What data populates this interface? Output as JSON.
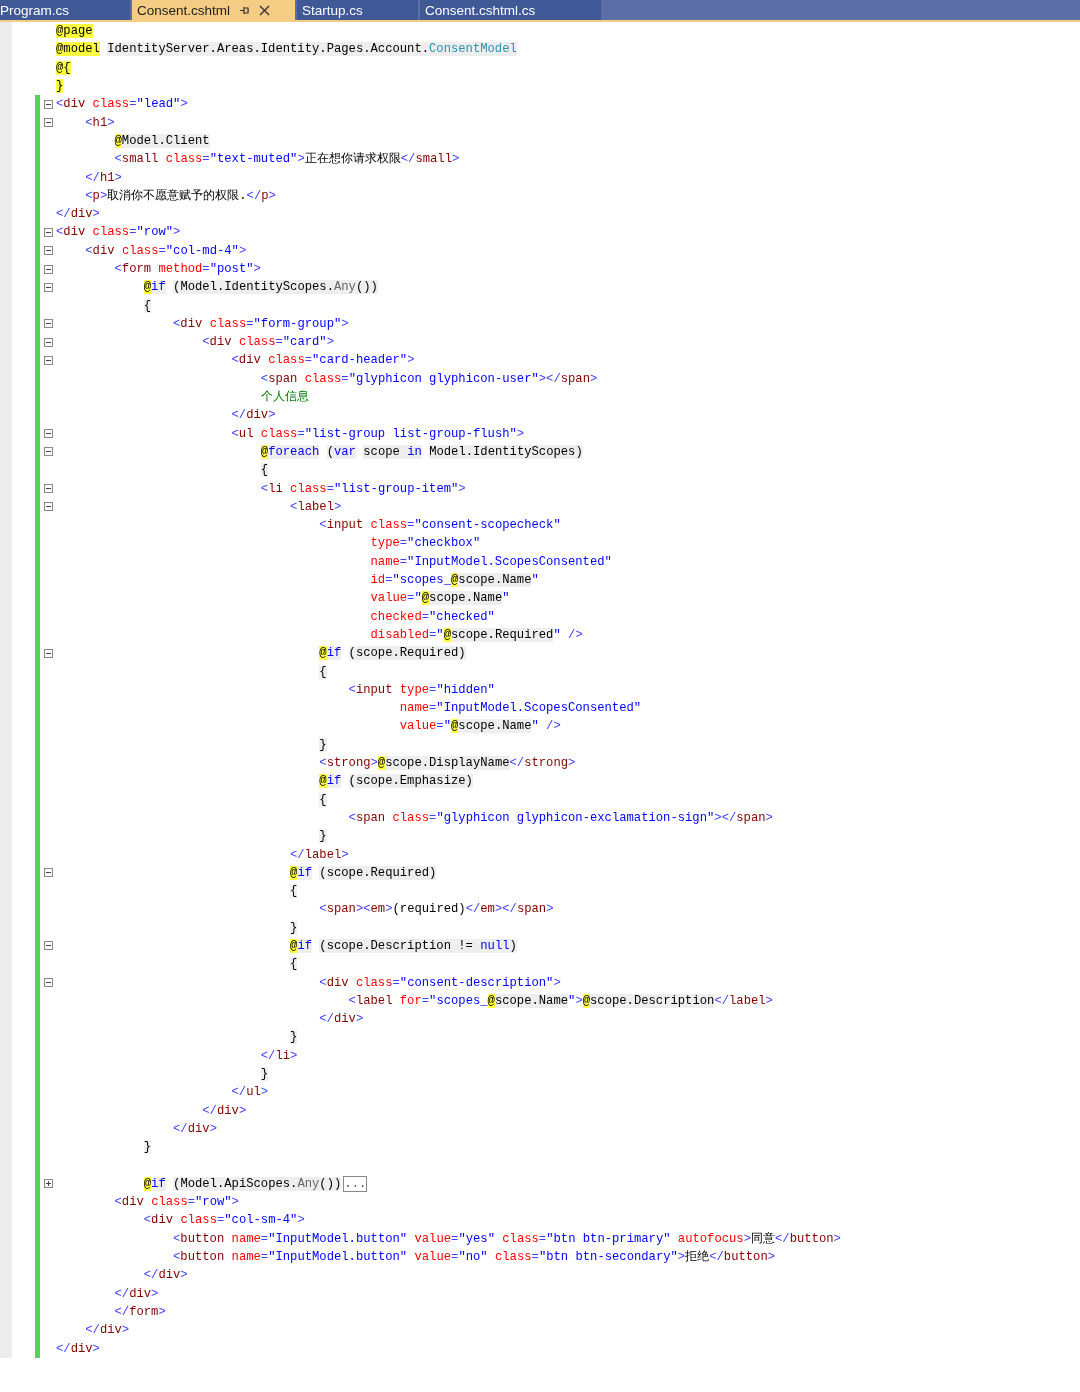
{
  "tabs": [
    {
      "label": "Program.cs",
      "selected": false
    },
    {
      "label": "Consent.cshtml",
      "selected": true
    },
    {
      "label": "Startup.cs",
      "selected": false
    },
    {
      "label": "Consent.cshtml.cs",
      "selected": false
    }
  ],
  "lines": [
    {
      "t": [
        {
          "kind": "at",
          "text": "@page"
        }
      ]
    },
    {
      "t": [
        {
          "kind": "at",
          "text": "@model"
        },
        {
          "kind": "cs",
          "text": " IdentityServer.Areas.Identity.Pages.Account."
        },
        {
          "kind": "ty",
          "text": "ConsentModel"
        }
      ]
    },
    {
      "t": [
        {
          "kind": "at",
          "text": "@{"
        }
      ]
    },
    {
      "t": [
        {
          "kind": "at",
          "text": "}"
        }
      ]
    },
    {
      "changed": true,
      "expanded": true,
      "t": [
        {
          "kind": "p",
          "text": "<"
        },
        {
          "kind": "tag",
          "text": "div"
        },
        {
          "kind": "attr",
          "text": " class"
        },
        {
          "kind": "p",
          "text": "="
        },
        {
          "kind": "str",
          "text": "\"lead\""
        },
        {
          "kind": "p",
          "text": ">"
        }
      ]
    },
    {
      "changed": true,
      "expanded": true,
      "t": [
        {
          "kind": "p",
          "text": "    <"
        },
        {
          "kind": "tag",
          "text": "h1"
        },
        {
          "kind": "p",
          "text": ">"
        }
      ]
    },
    {
      "changed": true,
      "t": [
        {
          "kind": "at",
          "text": "        @"
        },
        {
          "kind": "cs",
          "text": "Model.Client"
        }
      ]
    },
    {
      "changed": true,
      "t": [
        {
          "kind": "p",
          "text": "        <"
        },
        {
          "kind": "tag",
          "text": "small"
        },
        {
          "kind": "attr",
          "text": " class"
        },
        {
          "kind": "p",
          "text": "="
        },
        {
          "kind": "str",
          "text": "\"text-muted\""
        },
        {
          "kind": "p",
          "text": ">"
        },
        {
          "kind": "txt",
          "text": "正在想你请求权限"
        },
        {
          "kind": "p",
          "text": "</"
        },
        {
          "kind": "tag",
          "text": "small"
        },
        {
          "kind": "p",
          "text": ">"
        }
      ]
    },
    {
      "changed": true,
      "t": [
        {
          "kind": "p",
          "text": "    </"
        },
        {
          "kind": "tag",
          "text": "h1"
        },
        {
          "kind": "p",
          "text": ">"
        }
      ]
    },
    {
      "changed": true,
      "t": [
        {
          "kind": "p",
          "text": "    <"
        },
        {
          "kind": "tag",
          "text": "p"
        },
        {
          "kind": "p",
          "text": ">"
        },
        {
          "kind": "txt",
          "text": "取消你不愿意赋予的权限."
        },
        {
          "kind": "p",
          "text": "</"
        },
        {
          "kind": "tag",
          "text": "p"
        },
        {
          "kind": "p",
          "text": ">"
        }
      ]
    },
    {
      "changed": true,
      "t": [
        {
          "kind": "p",
          "text": "</"
        },
        {
          "kind": "tag",
          "text": "div"
        },
        {
          "kind": "p",
          "text": ">"
        }
      ]
    },
    {
      "changed": true,
      "expanded": true,
      "t": [
        {
          "kind": "p",
          "text": "<"
        },
        {
          "kind": "tag",
          "text": "div"
        },
        {
          "kind": "attr",
          "text": " class"
        },
        {
          "kind": "p",
          "text": "="
        },
        {
          "kind": "str",
          "text": "\"row\""
        },
        {
          "kind": "p",
          "text": ">"
        }
      ]
    },
    {
      "changed": true,
      "expanded": true,
      "t": [
        {
          "kind": "p",
          "text": "    <"
        },
        {
          "kind": "tag",
          "text": "div"
        },
        {
          "kind": "attr",
          "text": " class"
        },
        {
          "kind": "p",
          "text": "="
        },
        {
          "kind": "str",
          "text": "\"col-md-4\""
        },
        {
          "kind": "p",
          "text": ">"
        }
      ]
    },
    {
      "changed": true,
      "expanded": true,
      "t": [
        {
          "kind": "p",
          "text": "        <"
        },
        {
          "kind": "tag",
          "text": "form"
        },
        {
          "kind": "attr",
          "text": " method"
        },
        {
          "kind": "p",
          "text": "="
        },
        {
          "kind": "str",
          "text": "\"post\""
        },
        {
          "kind": "p",
          "text": ">"
        }
      ]
    },
    {
      "changed": true,
      "expanded": true,
      "t": [
        {
          "kind": "at",
          "text": "            @"
        },
        {
          "kind": "kw",
          "text": "if"
        },
        {
          "kind": "cs",
          "text": " (Model.IdentityScopes."
        },
        {
          "kind": "dim",
          "text": "Any"
        },
        {
          "kind": "cs",
          "text": "())"
        }
      ]
    },
    {
      "changed": true,
      "t": [
        {
          "kind": "cs",
          "text": "            {"
        }
      ]
    },
    {
      "changed": true,
      "expanded": true,
      "t": [
        {
          "kind": "p",
          "text": "                <"
        },
        {
          "kind": "tag",
          "text": "div"
        },
        {
          "kind": "attr",
          "text": " class"
        },
        {
          "kind": "p",
          "text": "="
        },
        {
          "kind": "str",
          "text": "\"form-group\""
        },
        {
          "kind": "p",
          "text": ">"
        }
      ]
    },
    {
      "changed": true,
      "expanded": true,
      "t": [
        {
          "kind": "p",
          "text": "                    <"
        },
        {
          "kind": "tag",
          "text": "div"
        },
        {
          "kind": "attr",
          "text": " class"
        },
        {
          "kind": "p",
          "text": "="
        },
        {
          "kind": "str",
          "text": "\"card\""
        },
        {
          "kind": "p",
          "text": ">"
        }
      ]
    },
    {
      "changed": true,
      "expanded": true,
      "t": [
        {
          "kind": "p",
          "text": "                        <"
        },
        {
          "kind": "tag",
          "text": "div"
        },
        {
          "kind": "attr",
          "text": " class"
        },
        {
          "kind": "p",
          "text": "="
        },
        {
          "kind": "str",
          "text": "\"card-header\""
        },
        {
          "kind": "p",
          "text": ">"
        }
      ]
    },
    {
      "changed": true,
      "t": [
        {
          "kind": "p",
          "text": "                            <"
        },
        {
          "kind": "tag",
          "text": "span"
        },
        {
          "kind": "attr",
          "text": " class"
        },
        {
          "kind": "p",
          "text": "="
        },
        {
          "kind": "str",
          "text": "\"glyphicon glyphicon-user\""
        },
        {
          "kind": "p",
          "text": "></"
        },
        {
          "kind": "tag",
          "text": "span"
        },
        {
          "kind": "p",
          "text": ">"
        }
      ]
    },
    {
      "changed": true,
      "t": [
        {
          "kind": "grn",
          "text": "                            个人信息"
        }
      ]
    },
    {
      "changed": true,
      "t": [
        {
          "kind": "p",
          "text": "                        </"
        },
        {
          "kind": "tag",
          "text": "div"
        },
        {
          "kind": "p",
          "text": ">"
        }
      ]
    },
    {
      "changed": true,
      "expanded": true,
      "t": [
        {
          "kind": "p",
          "text": "                        <"
        },
        {
          "kind": "tag",
          "text": "ul"
        },
        {
          "kind": "attr",
          "text": " class"
        },
        {
          "kind": "p",
          "text": "="
        },
        {
          "kind": "str",
          "text": "\"list-group list-group-flush\""
        },
        {
          "kind": "p",
          "text": ">"
        }
      ]
    },
    {
      "changed": true,
      "expanded": true,
      "t": [
        {
          "kind": "at",
          "text": "                            @"
        },
        {
          "kind": "kw",
          "text": "foreach"
        },
        {
          "kind": "cs",
          "text": " ("
        },
        {
          "kind": "kw",
          "text": "var"
        },
        {
          "kind": "cs",
          "text": " scope "
        },
        {
          "kind": "kw",
          "text": "in"
        },
        {
          "kind": "cs",
          "text": " Model.IdentityScopes)"
        }
      ]
    },
    {
      "changed": true,
      "t": [
        {
          "kind": "cs",
          "text": "                            {"
        }
      ]
    },
    {
      "changed": true,
      "expanded": true,
      "t": [
        {
          "kind": "p",
          "text": "                            <"
        },
        {
          "kind": "tag",
          "text": "li"
        },
        {
          "kind": "attr",
          "text": " class"
        },
        {
          "kind": "p",
          "text": "="
        },
        {
          "kind": "str",
          "text": "\"list-group-item\""
        },
        {
          "kind": "p",
          "text": ">"
        }
      ]
    },
    {
      "changed": true,
      "expanded": true,
      "t": [
        {
          "kind": "p",
          "text": "                                <"
        },
        {
          "kind": "tag",
          "text": "label"
        },
        {
          "kind": "p",
          "text": ">"
        }
      ]
    },
    {
      "changed": true,
      "t": [
        {
          "kind": "p",
          "text": "                                    <"
        },
        {
          "kind": "tag",
          "text": "input"
        },
        {
          "kind": "attr",
          "text": " class"
        },
        {
          "kind": "p",
          "text": "="
        },
        {
          "kind": "str",
          "text": "\"consent-scopecheck\""
        }
      ]
    },
    {
      "changed": true,
      "t": [
        {
          "kind": "attr",
          "text": "                                           type"
        },
        {
          "kind": "p",
          "text": "="
        },
        {
          "kind": "str",
          "text": "\"checkbox\""
        }
      ]
    },
    {
      "changed": true,
      "t": [
        {
          "kind": "attr",
          "text": "                                           name"
        },
        {
          "kind": "p",
          "text": "="
        },
        {
          "kind": "str",
          "text": "\"InputModel.ScopesConsented\""
        }
      ]
    },
    {
      "changed": true,
      "t": [
        {
          "kind": "attr",
          "text": "                                           id"
        },
        {
          "kind": "p",
          "text": "="
        },
        {
          "kind": "str",
          "text": "\"scopes_"
        },
        {
          "kind": "at",
          "text": "@"
        },
        {
          "kind": "cs",
          "text": "scope.Name"
        },
        {
          "kind": "str",
          "text": "\""
        }
      ]
    },
    {
      "changed": true,
      "t": [
        {
          "kind": "attr",
          "text": "                                           value"
        },
        {
          "kind": "p",
          "text": "="
        },
        {
          "kind": "str",
          "text": "\""
        },
        {
          "kind": "at",
          "text": "@"
        },
        {
          "kind": "cs",
          "text": "scope.Name"
        },
        {
          "kind": "str",
          "text": "\""
        }
      ]
    },
    {
      "changed": true,
      "t": [
        {
          "kind": "attr",
          "text": "                                           checked"
        },
        {
          "kind": "p",
          "text": "="
        },
        {
          "kind": "str",
          "text": "\"checked\""
        }
      ]
    },
    {
      "changed": true,
      "t": [
        {
          "kind": "attr",
          "text": "                                           disabled"
        },
        {
          "kind": "p",
          "text": "="
        },
        {
          "kind": "str",
          "text": "\""
        },
        {
          "kind": "at",
          "text": "@"
        },
        {
          "kind": "cs",
          "text": "scope.Required"
        },
        {
          "kind": "str",
          "text": "\""
        },
        {
          "kind": "p",
          "text": " />"
        }
      ]
    },
    {
      "changed": true,
      "expanded": true,
      "t": [
        {
          "kind": "at",
          "text": "                                    @"
        },
        {
          "kind": "kw",
          "text": "if"
        },
        {
          "kind": "cs",
          "text": " (scope.Required)"
        }
      ]
    },
    {
      "changed": true,
      "t": [
        {
          "kind": "cs",
          "text": "                                    {"
        }
      ]
    },
    {
      "changed": true,
      "t": [
        {
          "kind": "p",
          "text": "                                        <"
        },
        {
          "kind": "tag",
          "text": "input"
        },
        {
          "kind": "attr",
          "text": " type"
        },
        {
          "kind": "p",
          "text": "="
        },
        {
          "kind": "str",
          "text": "\"hidden\""
        }
      ]
    },
    {
      "changed": true,
      "t": [
        {
          "kind": "attr",
          "text": "                                               name"
        },
        {
          "kind": "p",
          "text": "="
        },
        {
          "kind": "str",
          "text": "\"InputModel.ScopesConsented\""
        }
      ]
    },
    {
      "changed": true,
      "t": [
        {
          "kind": "attr",
          "text": "                                               value"
        },
        {
          "kind": "p",
          "text": "="
        },
        {
          "kind": "str",
          "text": "\""
        },
        {
          "kind": "at",
          "text": "@"
        },
        {
          "kind": "cs",
          "text": "scope.Name"
        },
        {
          "kind": "str",
          "text": "\""
        },
        {
          "kind": "p",
          "text": " />"
        }
      ]
    },
    {
      "changed": true,
      "t": [
        {
          "kind": "cs",
          "text": "                                    }"
        }
      ]
    },
    {
      "changed": true,
      "t": [
        {
          "kind": "p",
          "text": "                                    <"
        },
        {
          "kind": "tag",
          "text": "strong"
        },
        {
          "kind": "p",
          "text": ">"
        },
        {
          "kind": "at",
          "text": "@"
        },
        {
          "kind": "cs",
          "text": "scope.DisplayName"
        },
        {
          "kind": "p",
          "text": "</"
        },
        {
          "kind": "tag",
          "text": "strong"
        },
        {
          "kind": "p",
          "text": ">"
        }
      ]
    },
    {
      "changed": true,
      "t": [
        {
          "kind": "at",
          "text": "                                    @"
        },
        {
          "kind": "kw",
          "text": "if"
        },
        {
          "kind": "cs",
          "text": " (scope.Emphasize)"
        }
      ]
    },
    {
      "changed": true,
      "t": [
        {
          "kind": "cs",
          "text": "                                    {"
        }
      ]
    },
    {
      "changed": true,
      "t": [
        {
          "kind": "p",
          "text": "                                        <"
        },
        {
          "kind": "tag",
          "text": "span"
        },
        {
          "kind": "attr",
          "text": " class"
        },
        {
          "kind": "p",
          "text": "="
        },
        {
          "kind": "str",
          "text": "\"glyphicon glyphicon-exclamation-sign\""
        },
        {
          "kind": "p",
          "text": "></"
        },
        {
          "kind": "tag",
          "text": "span"
        },
        {
          "kind": "p",
          "text": ">"
        }
      ]
    },
    {
      "changed": true,
      "t": [
        {
          "kind": "cs",
          "text": "                                    }"
        }
      ]
    },
    {
      "changed": true,
      "t": [
        {
          "kind": "p",
          "text": "                                </"
        },
        {
          "kind": "tag",
          "text": "label"
        },
        {
          "kind": "p",
          "text": ">"
        }
      ]
    },
    {
      "changed": true,
      "expanded": true,
      "t": [
        {
          "kind": "at",
          "text": "                                @"
        },
        {
          "kind": "kw",
          "text": "if"
        },
        {
          "kind": "cs",
          "text": " (scope.Required)"
        }
      ]
    },
    {
      "changed": true,
      "t": [
        {
          "kind": "cs",
          "text": "                                {"
        }
      ]
    },
    {
      "changed": true,
      "t": [
        {
          "kind": "p",
          "text": "                                    <"
        },
        {
          "kind": "tag",
          "text": "span"
        },
        {
          "kind": "p",
          "text": "><"
        },
        {
          "kind": "tag",
          "text": "em"
        },
        {
          "kind": "p",
          "text": ">"
        },
        {
          "kind": "txt",
          "text": "(required)"
        },
        {
          "kind": "p",
          "text": "</"
        },
        {
          "kind": "tag",
          "text": "em"
        },
        {
          "kind": "p",
          "text": "></"
        },
        {
          "kind": "tag",
          "text": "span"
        },
        {
          "kind": "p",
          "text": ">"
        }
      ]
    },
    {
      "changed": true,
      "t": [
        {
          "kind": "cs",
          "text": "                                }"
        }
      ]
    },
    {
      "changed": true,
      "expanded": true,
      "t": [
        {
          "kind": "at",
          "text": "                                @"
        },
        {
          "kind": "kw",
          "text": "if"
        },
        {
          "kind": "cs",
          "text": " (scope.Description != "
        },
        {
          "kind": "kw",
          "text": "null"
        },
        {
          "kind": "cs",
          "text": ")"
        }
      ]
    },
    {
      "changed": true,
      "t": [
        {
          "kind": "cs",
          "text": "                                {"
        }
      ]
    },
    {
      "changed": true,
      "expanded": true,
      "t": [
        {
          "kind": "p",
          "text": "                                    <"
        },
        {
          "kind": "tag",
          "text": "div"
        },
        {
          "kind": "attr",
          "text": " class"
        },
        {
          "kind": "p",
          "text": "="
        },
        {
          "kind": "str",
          "text": "\"consent-description\""
        },
        {
          "kind": "p",
          "text": ">"
        }
      ]
    },
    {
      "changed": true,
      "t": [
        {
          "kind": "p",
          "text": "                                        <"
        },
        {
          "kind": "tag",
          "text": "label"
        },
        {
          "kind": "attr",
          "text": " for"
        },
        {
          "kind": "p",
          "text": "="
        },
        {
          "kind": "str",
          "text": "\"scopes_"
        },
        {
          "kind": "at",
          "text": "@"
        },
        {
          "kind": "cs",
          "text": "scope.Name"
        },
        {
          "kind": "str",
          "text": "\""
        },
        {
          "kind": "p",
          "text": ">"
        },
        {
          "kind": "at",
          "text": "@"
        },
        {
          "kind": "cs",
          "text": "scope.Description"
        },
        {
          "kind": "p",
          "text": "</"
        },
        {
          "kind": "tag",
          "text": "label"
        },
        {
          "kind": "p",
          "text": ">"
        }
      ]
    },
    {
      "changed": true,
      "t": [
        {
          "kind": "p",
          "text": "                                    </"
        },
        {
          "kind": "tag",
          "text": "div"
        },
        {
          "kind": "p",
          "text": ">"
        }
      ]
    },
    {
      "changed": true,
      "t": [
        {
          "kind": "cs",
          "text": "                                }"
        }
      ]
    },
    {
      "changed": true,
      "t": [
        {
          "kind": "p",
          "text": "                            </"
        },
        {
          "kind": "tag",
          "text": "li"
        },
        {
          "kind": "p",
          "text": ">"
        }
      ]
    },
    {
      "changed": true,
      "t": [
        {
          "kind": "cs",
          "text": "                            }"
        }
      ]
    },
    {
      "changed": true,
      "t": [
        {
          "kind": "p",
          "text": "                        </"
        },
        {
          "kind": "tag",
          "text": "ul"
        },
        {
          "kind": "p",
          "text": ">"
        }
      ]
    },
    {
      "changed": true,
      "t": [
        {
          "kind": "p",
          "text": "                    </"
        },
        {
          "kind": "tag",
          "text": "div"
        },
        {
          "kind": "p",
          "text": ">"
        }
      ]
    },
    {
      "changed": true,
      "t": [
        {
          "kind": "p",
          "text": "                </"
        },
        {
          "kind": "tag",
          "text": "div"
        },
        {
          "kind": "p",
          "text": ">"
        }
      ]
    },
    {
      "changed": true,
      "t": [
        {
          "kind": "cs",
          "text": "            }"
        }
      ]
    },
    {
      "changed": true
    },
    {
      "changed": true,
      "expanded": false,
      "t": [
        {
          "kind": "at",
          "text": "            @"
        },
        {
          "kind": "kw",
          "text": "if"
        },
        {
          "kind": "cs",
          "text": " (Model.ApiScopes."
        },
        {
          "kind": "dim",
          "text": "Any"
        },
        {
          "kind": "cs",
          "text": "())"
        },
        {
          "kind": "more",
          "text": "..."
        }
      ]
    },
    {
      "changed": true,
      "t": [
        {
          "kind": "p",
          "text": "        <"
        },
        {
          "kind": "tag",
          "text": "div"
        },
        {
          "kind": "attr",
          "text": " class"
        },
        {
          "kind": "p",
          "text": "="
        },
        {
          "kind": "str",
          "text": "\"row\""
        },
        {
          "kind": "p",
          "text": ">"
        }
      ]
    },
    {
      "changed": true,
      "t": [
        {
          "kind": "p",
          "text": "            <"
        },
        {
          "kind": "tag",
          "text": "div"
        },
        {
          "kind": "attr",
          "text": " class"
        },
        {
          "kind": "p",
          "text": "="
        },
        {
          "kind": "str",
          "text": "\"col-sm-4\""
        },
        {
          "kind": "p",
          "text": ">"
        }
      ]
    },
    {
      "changed": true,
      "t": [
        {
          "kind": "p",
          "text": "                <"
        },
        {
          "kind": "tag",
          "text": "button"
        },
        {
          "kind": "attr",
          "text": " name"
        },
        {
          "kind": "p",
          "text": "="
        },
        {
          "kind": "str",
          "text": "\"InputModel.button\""
        },
        {
          "kind": "attr",
          "text": " value"
        },
        {
          "kind": "p",
          "text": "="
        },
        {
          "kind": "str",
          "text": "\"yes\""
        },
        {
          "kind": "attr",
          "text": " class"
        },
        {
          "kind": "p",
          "text": "="
        },
        {
          "kind": "str",
          "text": "\"btn btn-primary\""
        },
        {
          "kind": "attr",
          "text": " autofocus"
        },
        {
          "kind": "p",
          "text": ">"
        },
        {
          "kind": "txt",
          "text": "同意"
        },
        {
          "kind": "p",
          "text": "</"
        },
        {
          "kind": "tag",
          "text": "button"
        },
        {
          "kind": "p",
          "text": ">"
        }
      ]
    },
    {
      "changed": true,
      "t": [
        {
          "kind": "p",
          "text": "                <"
        },
        {
          "kind": "tag",
          "text": "button"
        },
        {
          "kind": "attr",
          "text": " name"
        },
        {
          "kind": "p",
          "text": "="
        },
        {
          "kind": "str",
          "text": "\"InputModel.button\""
        },
        {
          "kind": "attr",
          "text": " value"
        },
        {
          "kind": "p",
          "text": "="
        },
        {
          "kind": "str",
          "text": "\"no\""
        },
        {
          "kind": "attr",
          "text": " class"
        },
        {
          "kind": "p",
          "text": "="
        },
        {
          "kind": "str",
          "text": "\"btn btn-secondary\""
        },
        {
          "kind": "p",
          "text": ">"
        },
        {
          "kind": "txt",
          "text": "拒绝"
        },
        {
          "kind": "p",
          "text": "</"
        },
        {
          "kind": "tag",
          "text": "button"
        },
        {
          "kind": "p",
          "text": ">"
        }
      ]
    },
    {
      "changed": true,
      "t": [
        {
          "kind": "p",
          "text": "            </"
        },
        {
          "kind": "tag",
          "text": "div"
        },
        {
          "kind": "p",
          "text": ">"
        }
      ]
    },
    {
      "changed": true,
      "t": [
        {
          "kind": "p",
          "text": "        </"
        },
        {
          "kind": "tag",
          "text": "div"
        },
        {
          "kind": "p",
          "text": ">"
        }
      ]
    },
    {
      "changed": true,
      "t": [
        {
          "kind": "p",
          "text": "        </"
        },
        {
          "kind": "tag",
          "text": "form"
        },
        {
          "kind": "p",
          "text": ">"
        }
      ]
    },
    {
      "changed": true,
      "t": [
        {
          "kind": "p",
          "text": "    </"
        },
        {
          "kind": "tag",
          "text": "div"
        },
        {
          "kind": "p",
          "text": ">"
        }
      ]
    },
    {
      "changed": true,
      "t": [
        {
          "kind": "p",
          "text": "</"
        },
        {
          "kind": "tag",
          "text": "div"
        },
        {
          "kind": "p",
          "text": ">"
        }
      ]
    }
  ]
}
